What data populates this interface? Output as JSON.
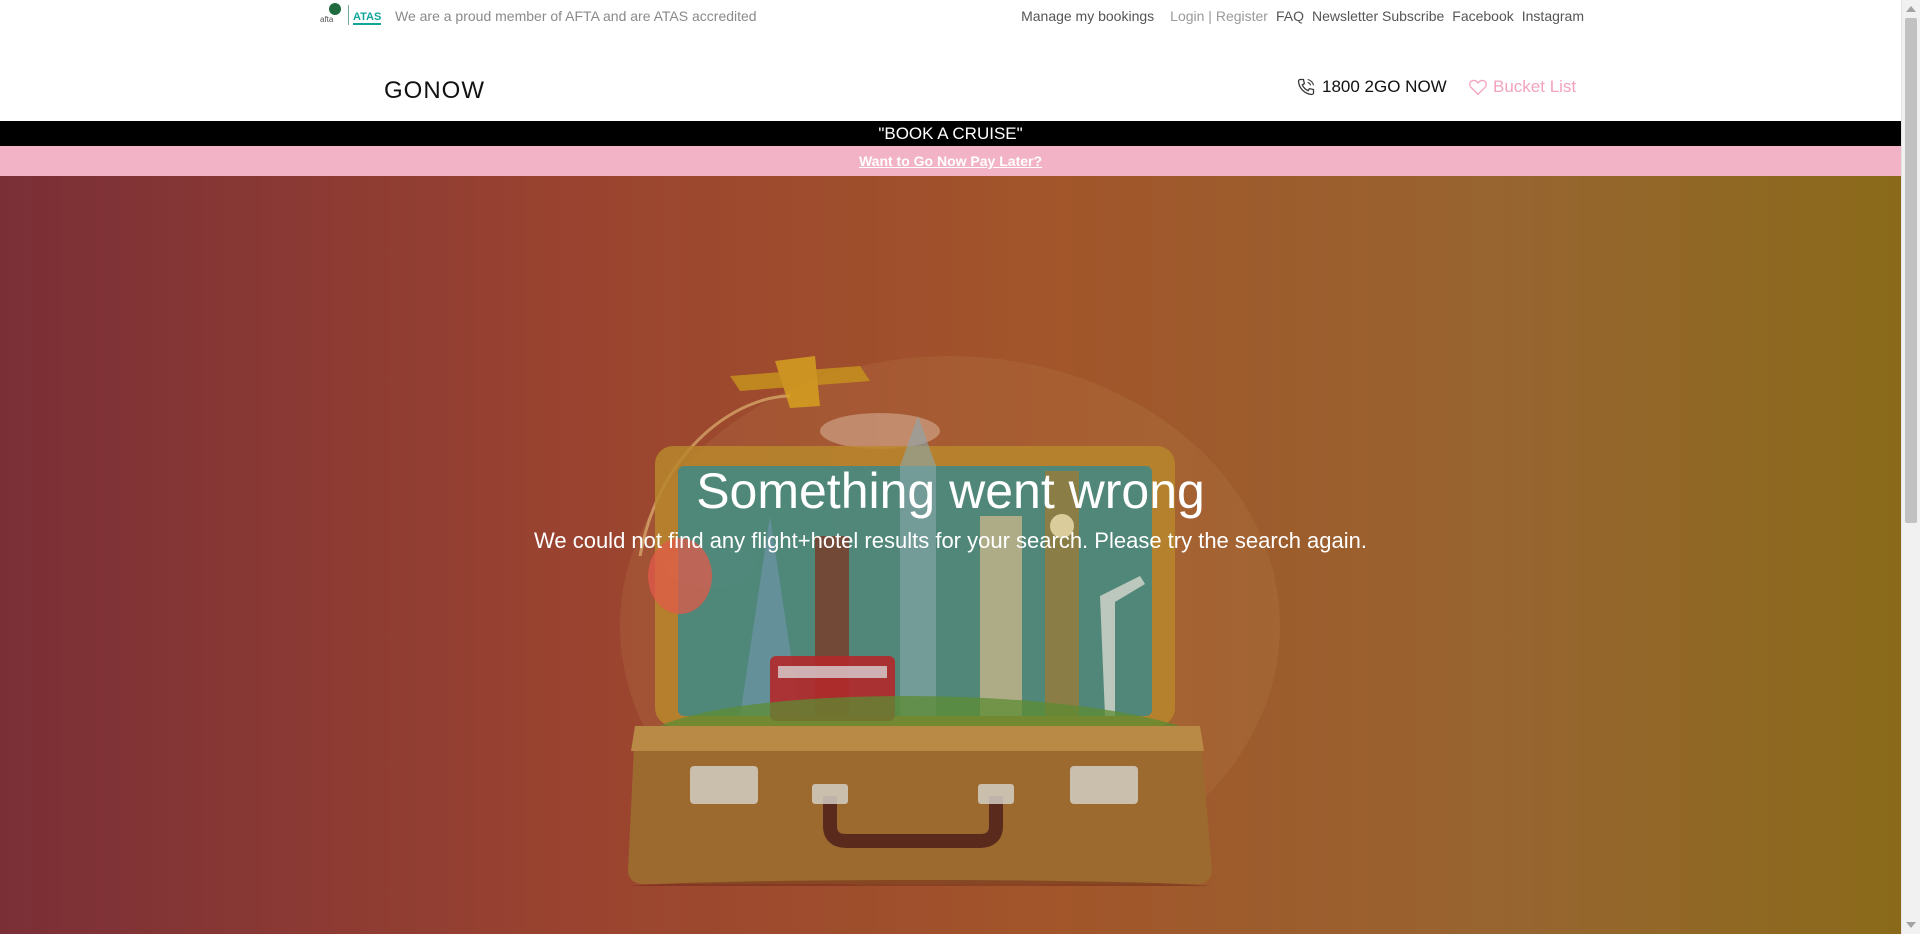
{
  "topbar": {
    "afta_badge": "afta",
    "atas_badge": "ATAS",
    "member_text": "We are a proud member of AFTA and are ATAS accredited",
    "links": {
      "manage": "Manage my bookings",
      "login": "Login | Register",
      "faq": "FAQ",
      "newsletter": "Newsletter Subscribe",
      "facebook": "Facebook",
      "instagram": "Instagram"
    }
  },
  "header": {
    "logo": "GONOW",
    "phone": "1800 2GO NOW",
    "bucket_list": "Bucket List",
    "icons": {
      "phone": "phone-icon",
      "bucket": "heart-icon"
    }
  },
  "banner": {
    "cruise": "\"BOOK A CRUISE\"",
    "pay_later": "Want to Go Now Pay Later?"
  },
  "hero": {
    "title": "Something went wrong",
    "message": "We could not find any flight+hotel results for your search. Please try the search again.",
    "illustration": "suitcase-landmarks-illustration"
  },
  "colors": {
    "pink_accent": "#f2b3c6",
    "heart_pink": "#f2a3bd",
    "cruise_bar": "#000000",
    "hero_left": "#7a2f37",
    "hero_right": "#8a6a1a"
  }
}
